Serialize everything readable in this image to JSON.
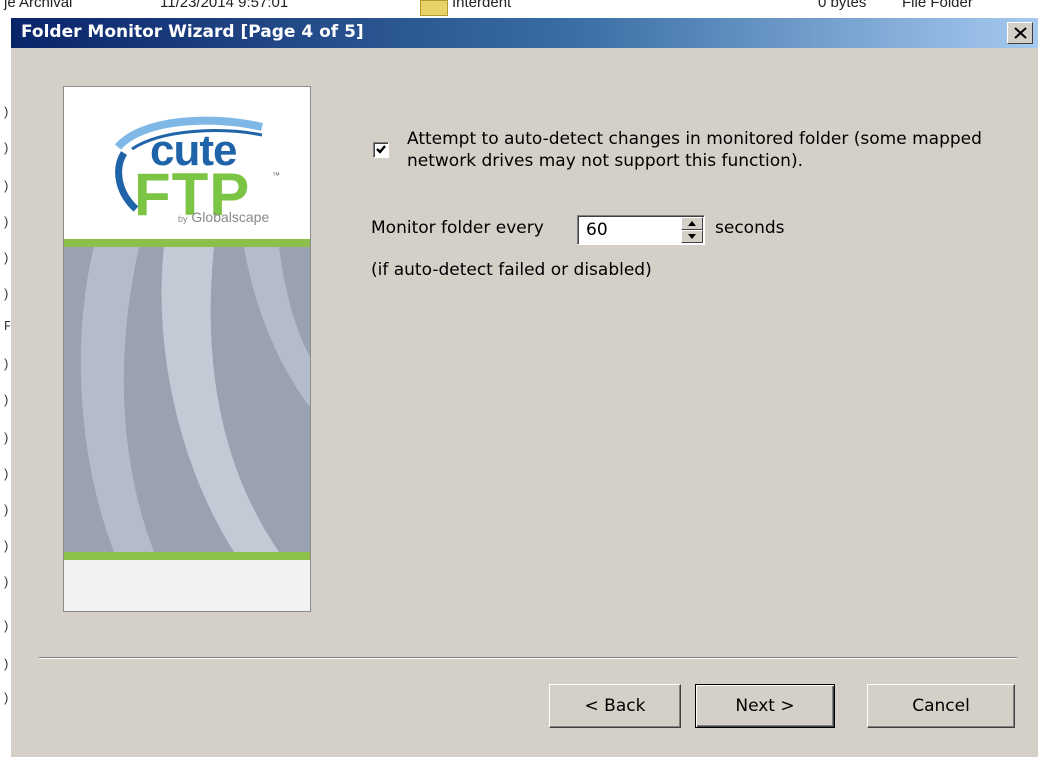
{
  "background_window": {
    "text_1": "je Archival",
    "text_2": "11/23/2014 9:57:01",
    "text_3": "Interdent",
    "text_4": "0 bytes",
    "text_5": "File Folder",
    "left_fragments": [
      ")",
      ")",
      ")",
      ")",
      ")",
      ")",
      "F",
      ")",
      ")",
      ")",
      ")",
      ")",
      ")",
      ")",
      ")",
      ")",
      ")"
    ]
  },
  "dialog": {
    "title": "Folder Monitor Wizard [Page 4 of 5]",
    "close_icon": "close-x"
  },
  "logo": {
    "word_cute": "cute",
    "word_ftp": "FTP",
    "tm": "™",
    "by": "by",
    "company": "Globalscape",
    "colors": {
      "blue": "#1f63a8",
      "green": "#7cc443",
      "stripe": "#9aa2b2"
    }
  },
  "options": {
    "auto_detect_checked": true,
    "auto_detect_label": "Attempt to auto-detect changes in monitored folder (some mapped network drives may not support this function).",
    "monitor_label": "Monitor folder every",
    "interval_value": "60",
    "seconds_label": "seconds",
    "note": "(if auto-detect failed or disabled)"
  },
  "buttons": {
    "back": "< Back",
    "next": "Next >",
    "cancel": "Cancel"
  }
}
